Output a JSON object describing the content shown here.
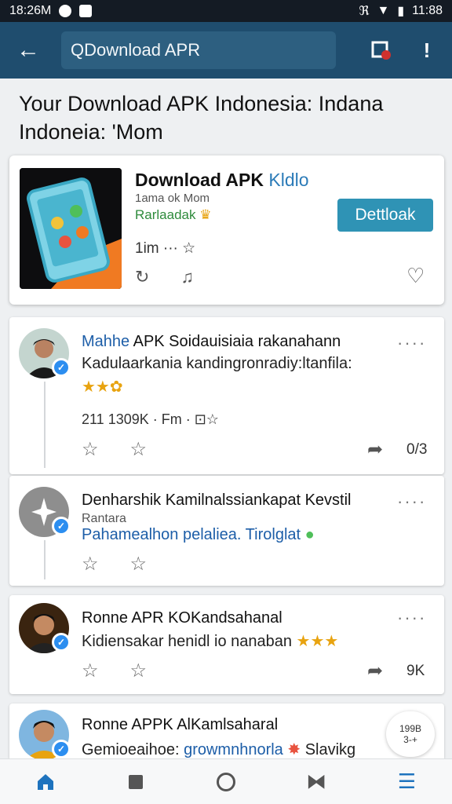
{
  "status_bar": {
    "time_left": "18:26M",
    "time_right": "11:88"
  },
  "app_bar": {
    "back_icon": "arrow-left-icon",
    "search_text": "QDownload APR"
  },
  "page_title": "Your Download APK Indonesia: Indana Indoneia: 'Mom",
  "featured": {
    "title": "Download APK",
    "title_accent": "Kldlo",
    "meta": "1ama ok Mom",
    "category": "Rarlaadak",
    "size": "1im ··· ☆",
    "download_label": "Dettloak"
  },
  "posts": [
    {
      "name_blue": "Mahhe",
      "name": " APK Soidauisiaia rakanahann",
      "body": "Kadulaarkania kandingronradiy:ltanfila:",
      "stats": "211 1309K · Fm · ⊡☆",
      "share_count": "0/3"
    },
    {
      "name": "Denharshik Kamilnalssiankapat Kevstil",
      "sub": "Rantara",
      "link": "Pahamealhon pelaliea. Tirolglat"
    },
    {
      "name": "Ronne APR KOKandsahanal",
      "body": "Kidiensakar henidl io nanaban",
      "share_count": "9K"
    },
    {
      "name": "Ronne APPK AlKamlsaharal",
      "body_start": "Gemioeaihoe: ",
      "body_link": "growmnhnorla",
      "body_end": " Slavikg"
    }
  ],
  "fab": {
    "line1": "199B",
    "line2": "3-+"
  },
  "colors": {
    "appbar": "#1f4d6e",
    "accent": "#2f93b5",
    "link": "#1d5ea8"
  }
}
